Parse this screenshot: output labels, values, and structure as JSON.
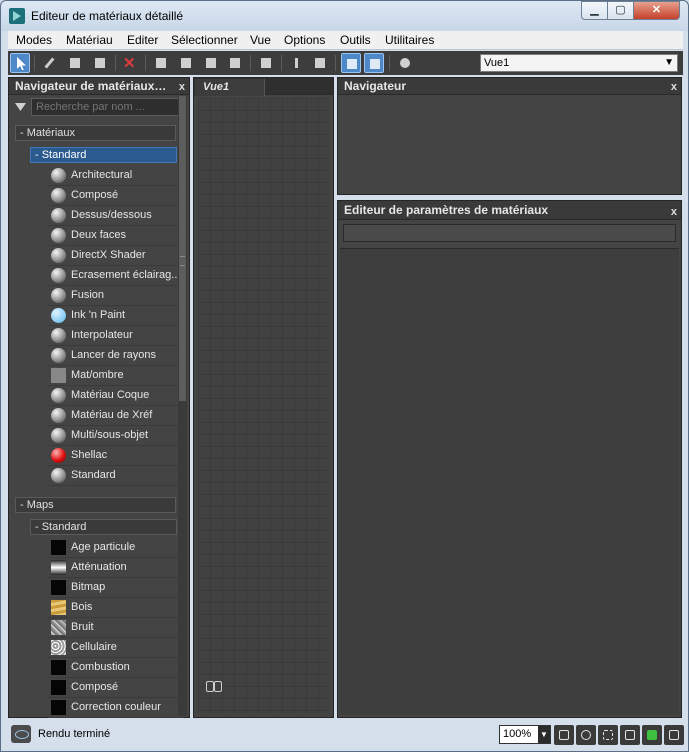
{
  "window": {
    "title": "Editeur de matériaux détaillé",
    "controls": {
      "minimize": "▁",
      "maximize": "▢",
      "close": "✕"
    }
  },
  "menu": [
    "Modes",
    "Matériau",
    "Editer",
    "Sélectionner",
    "Vue",
    "Options",
    "Outils",
    "Utilitaires"
  ],
  "toolbar": {
    "view_select": {
      "value": "Vue1",
      "dropdown": "▼"
    }
  },
  "browser": {
    "title": "Navigateur de matériaux…",
    "close": "x",
    "search_placeholder": "Recherche par nom ...",
    "materials_header": "- Matériaux",
    "materials_sub": "- Standard",
    "materials": [
      {
        "label": "Architectural",
        "swatch": "sphere"
      },
      {
        "label": "Composé",
        "swatch": "sphere"
      },
      {
        "label": "Dessus/dessous",
        "swatch": "sphere"
      },
      {
        "label": "Deux faces",
        "swatch": "sphere"
      },
      {
        "label": "DirectX Shader",
        "swatch": "sphere"
      },
      {
        "label": "Ecrasement éclairag...",
        "swatch": "sphere"
      },
      {
        "label": "Fusion",
        "swatch": "sphere"
      },
      {
        "label": "Ink 'n Paint",
        "swatch": "blue"
      },
      {
        "label": "Interpolateur",
        "swatch": "sphere"
      },
      {
        "label": "Lancer de rayons",
        "swatch": "sphere"
      },
      {
        "label": "Mat/ombre",
        "swatch": "flat"
      },
      {
        "label": "Matériau Coque",
        "swatch": "sphere"
      },
      {
        "label": "Matériau de Xréf",
        "swatch": "sphere"
      },
      {
        "label": "Multi/sous-objet",
        "swatch": "sphere"
      },
      {
        "label": "Shellac",
        "swatch": "red"
      },
      {
        "label": "Standard",
        "swatch": "sphere"
      }
    ],
    "maps_header": "- Maps",
    "maps_sub": "- Standard",
    "maps": [
      {
        "label": "Age particule",
        "swatch": "black"
      },
      {
        "label": "Atténuation",
        "swatch": "fade"
      },
      {
        "label": "Bitmap",
        "swatch": "black"
      },
      {
        "label": "Bois",
        "swatch": "bois"
      },
      {
        "label": "Bruit",
        "swatch": "bruit"
      },
      {
        "label": "Cellulaire",
        "swatch": "cell"
      },
      {
        "label": "Combustion",
        "swatch": "black"
      },
      {
        "label": "Composé",
        "swatch": "black"
      },
      {
        "label": "Correction couleur",
        "swatch": "black"
      }
    ]
  },
  "view": {
    "tab": "Vue1",
    "icon": "binoculars-icon"
  },
  "navigator": {
    "title": "Navigateur",
    "close": "x"
  },
  "params": {
    "title": "Editeur de paramètres de matériaux",
    "close": "x"
  },
  "status": {
    "text": "Rendu terminé",
    "zoom": "100%",
    "zoom_dropdown": "▼"
  },
  "colors": {
    "accent": "#2b5a8f",
    "panel": "#444444",
    "chrome": "#d4dfeb"
  }
}
